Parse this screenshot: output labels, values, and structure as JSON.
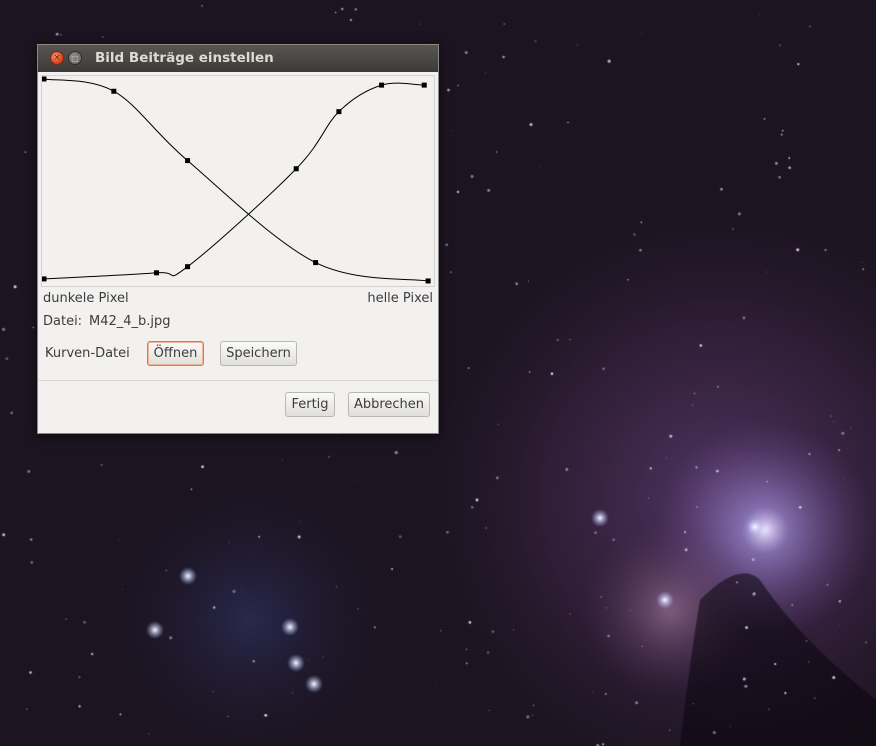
{
  "window": {
    "title": "Bild Beiträge einstellen",
    "close_glyph": "×",
    "minimize_glyph": "□"
  },
  "curve_editor": {
    "dark_label": "dunkele Pixel",
    "bright_label": "helle Pixel",
    "curve_color": "#000000",
    "rising_curve": [
      [
        0,
        1.0
      ],
      [
        0.18,
        0.94
      ],
      [
        0.37,
        0.6
      ],
      [
        0.7,
        0.1
      ],
      [
        0.99,
        0.01
      ]
    ],
    "falling_curve": [
      [
        0.0,
        0.02
      ],
      [
        0.29,
        0.05
      ],
      [
        0.37,
        0.08
      ],
      [
        0.65,
        0.56
      ],
      [
        0.76,
        0.84
      ],
      [
        0.87,
        0.97
      ],
      [
        0.98,
        0.97
      ]
    ]
  },
  "file": {
    "label": "Datei:",
    "name": "M42_4_b.jpg"
  },
  "curve_file": {
    "label": "Kurven-Datei",
    "open_button": "Öffnen",
    "save_button": "Speichern"
  },
  "actions": {
    "done_button": "Fertig",
    "cancel_button": "Abbrechen"
  },
  "colors": {
    "close_button": "#e0471f",
    "focus_ring": "#e2784e",
    "dialog_background": "#f2f1f0",
    "titlebar": "#3c3b37"
  }
}
